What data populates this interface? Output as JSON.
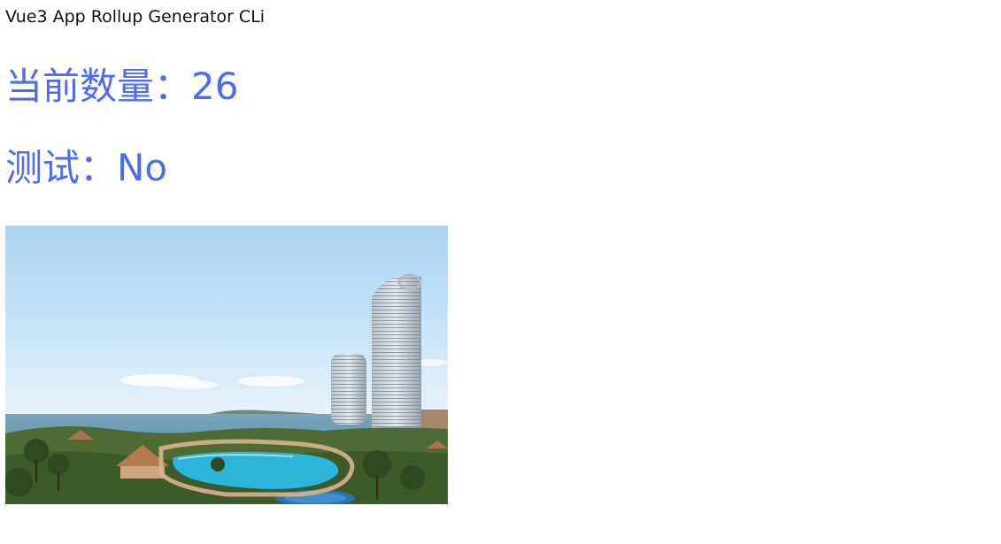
{
  "app": {
    "title": "Vue3 App Rollup Generator CLi"
  },
  "counter": {
    "label": "当前数量：",
    "value": "26"
  },
  "test": {
    "label": "测试：",
    "value": "No"
  },
  "colors": {
    "accent": "#4f6cf0",
    "text": "#111111",
    "background": "#ffffff"
  },
  "image": {
    "subject": "seaside resort with pool and high-rise hotel towers"
  }
}
